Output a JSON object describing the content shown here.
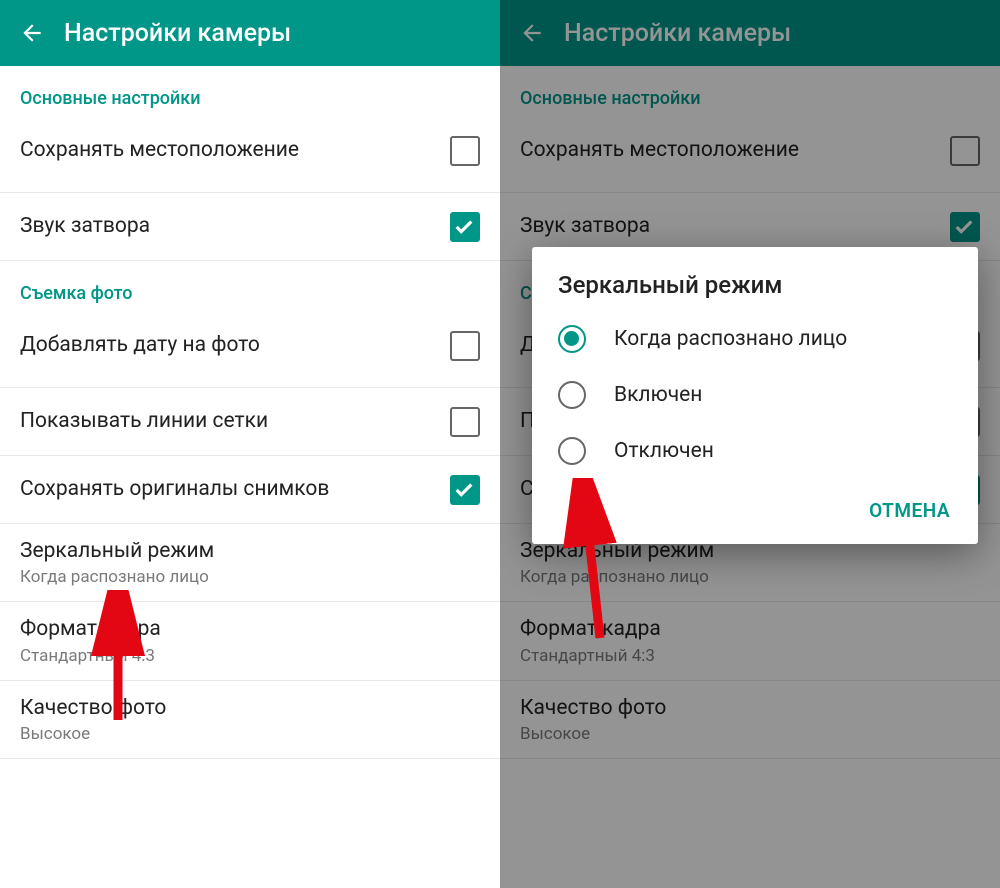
{
  "appbar": {
    "title": "Настройки камеры"
  },
  "sections": {
    "main": {
      "header": "Основные настройки"
    },
    "photo": {
      "header": "Съемка фото"
    }
  },
  "rows": {
    "save_location": {
      "label": "Сохранять местоположение"
    },
    "shutter_sound": {
      "label": "Звук затвора"
    },
    "add_date": {
      "label": "Добавлять дату на фото"
    },
    "grid_lines": {
      "label": "Показывать линии сетки"
    },
    "save_originals": {
      "label": "Сохранять оригиналы снимков"
    },
    "mirror_mode": {
      "label": "Зеркальный режим",
      "value": "Когда распознано лицо"
    },
    "frame_format": {
      "label": "Формат кадра",
      "value": "Стандартный 4:3"
    },
    "photo_quality": {
      "label": "Качество фото",
      "value": "Высокое"
    }
  },
  "dialog": {
    "title": "Зеркальный режим",
    "options": {
      "face": "Когда распознано лицо",
      "on": "Включен",
      "off": "Отключен"
    },
    "cancel": "ОТМЕНА"
  }
}
